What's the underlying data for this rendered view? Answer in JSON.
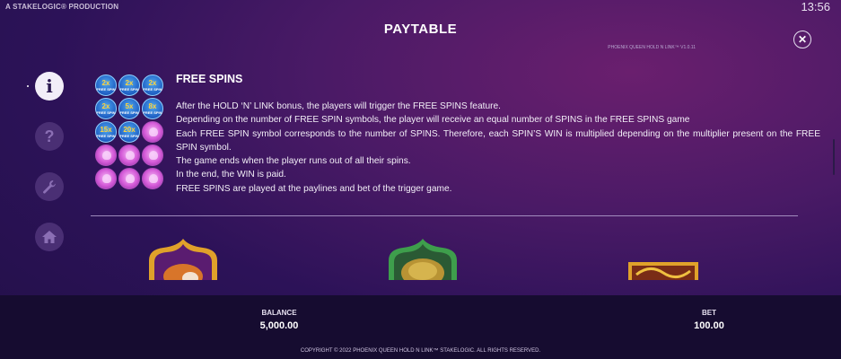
{
  "header": {
    "production": "A STAKELOGIC® PRODUCTION",
    "clock": "13:56",
    "title": "PAYTABLE",
    "version": "PHOENIX QUEEN HOLD N LINK™ V1.0.11",
    "close_glyph": "✕"
  },
  "sidebar": {
    "items": [
      {
        "name": "info",
        "glyph": "i",
        "active": true
      },
      {
        "name": "help",
        "glyph": "?",
        "active": false
      },
      {
        "name": "settings",
        "glyph": "wrench",
        "active": false
      },
      {
        "name": "home",
        "glyph": "home",
        "active": false
      }
    ]
  },
  "free_spins": {
    "title": "FREE SPINS",
    "coins": [
      {
        "mult": "2x",
        "label": "FREE SPIN"
      },
      {
        "mult": "2x",
        "label": "FREE SPIN"
      },
      {
        "mult": "2x",
        "label": "FREE SPIN"
      },
      {
        "mult": "2x",
        "label": "FREE SPIN"
      },
      {
        "mult": "5x",
        "label": "FREE SPIN"
      },
      {
        "mult": "8x",
        "label": "FREE SPIN"
      },
      {
        "mult": "15x",
        "label": "FREE SPIN"
      },
      {
        "mult": "20x",
        "label": "FREE SPIN"
      }
    ],
    "lotus_count": 7,
    "paragraphs": [
      "After the HOLD ‘N’ LINK bonus, the players will trigger the FREE SPINS feature.",
      "Depending on the number of FREE SPIN symbols, the player will receive an equal number of SPINS in the FREE SPINS game",
      "Each FREE SPIN symbol corresponds to the number of SPINS. Therefore, each SPIN’S WIN is multiplied depending on the multiplier present on the FREE SPIN symbol.",
      "The game ends when the player runs out of all their spins.",
      "In the end, the WIN is paid.",
      "FREE SPINS are played at the paylines and bet of the trigger game."
    ]
  },
  "footer": {
    "balance_label": "BALANCE",
    "balance_value": "5,000.00",
    "bet_label": "BET",
    "bet_value": "100.00",
    "copyright": "COPYRIGHT © 2022 PHOENIX QUEEN HOLD N LINK™ STAKELOGIC. ALL RIGHTS RESERVED."
  },
  "colors": {
    "accent_gold": "#e8a72a",
    "coin_blue": "#1f5fc4",
    "lotus_pink": "#d45ad8"
  }
}
